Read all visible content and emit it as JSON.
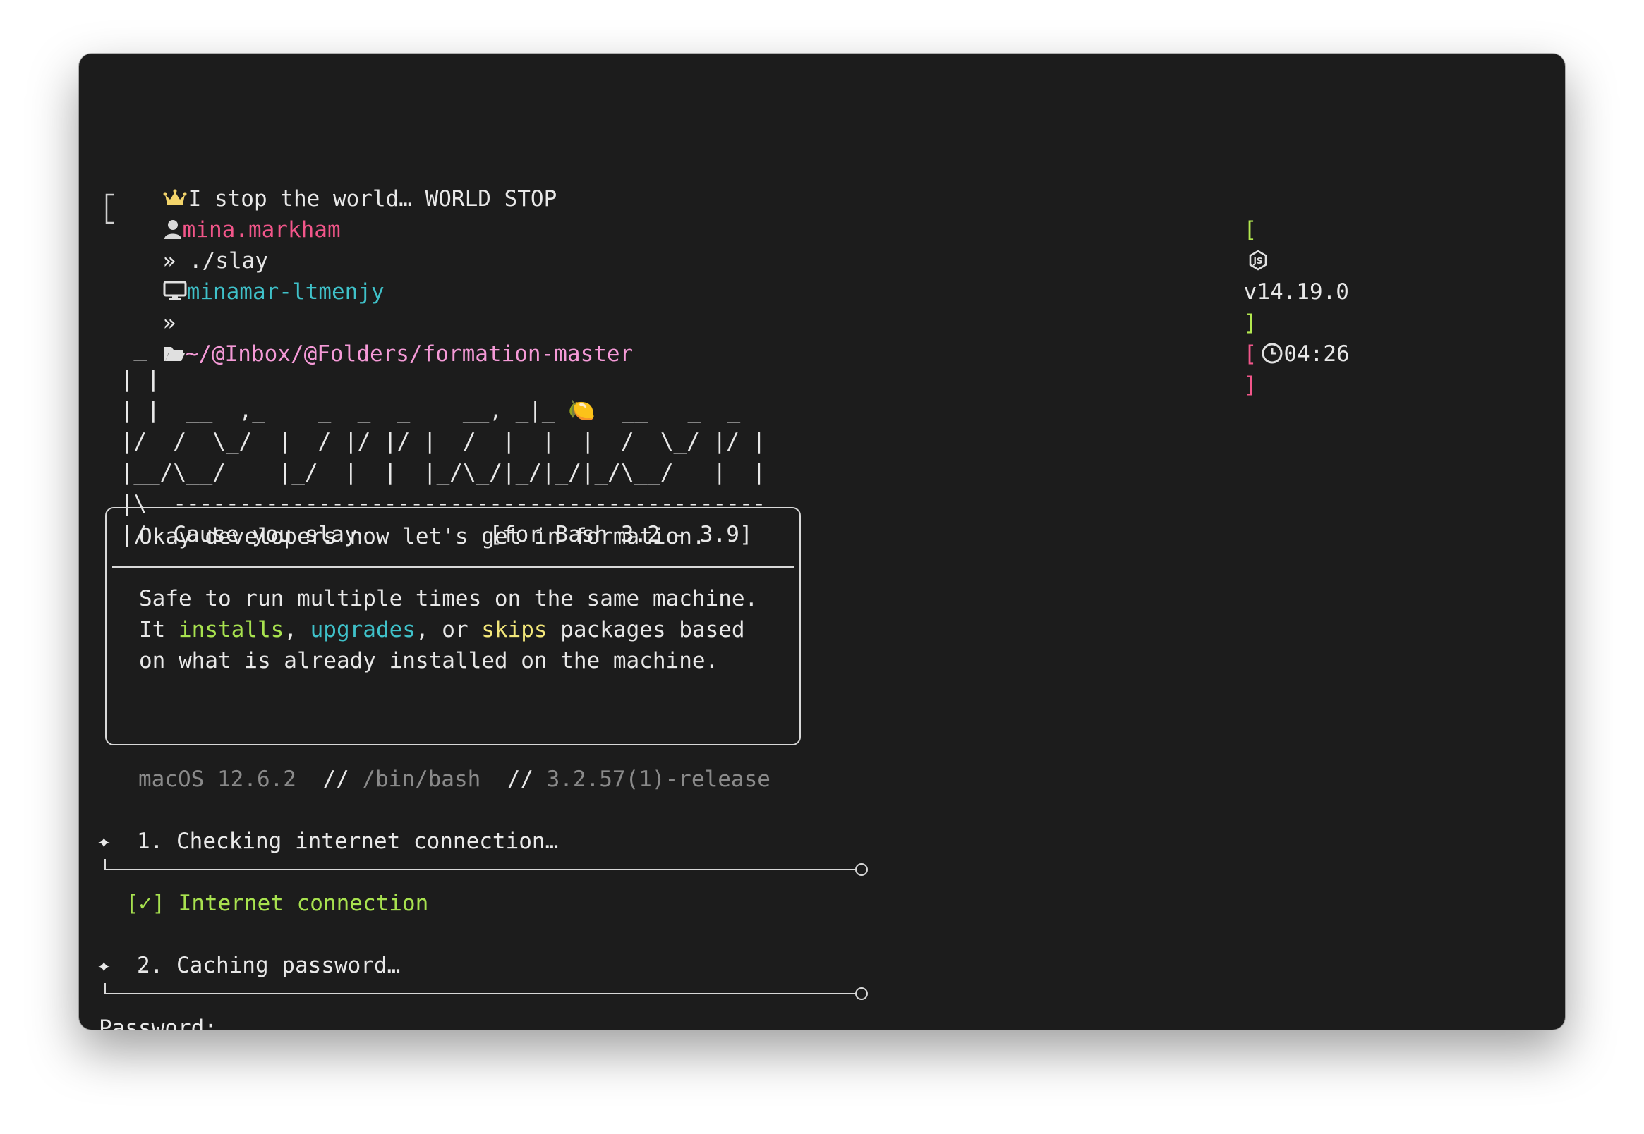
{
  "terminal": {
    "motd": "I stop the world… WORLD STOP",
    "prompt": {
      "user": "mina.markham",
      "host": "minamar-ltmenjy",
      "path": "~/@Inbox/@Folders/formation-master",
      "node_version": "v14.19.0",
      "time": "04:26",
      "separator": "»",
      "bracket_open": "[",
      "bracket_close": "]"
    },
    "command": "./slay",
    "banner": {
      "ascii_art": "  _\n | |\n | |  __  ,_    _  _  _    __, _|_ 🍋  __   _  _\n |/  /  \\_/  |  / |/ |/ |  /  |  |  |  /  \\_/ |/ |\n |__/\\__/    |_/  |  |  |_/\\_/|_/|_/|_/\\__/   |  |\n |\\  ---------------------------------------------\n |/  Cause you slay          [for Bash 3.2 - 3.9]"
    },
    "infobox": {
      "heading": "Okay developers now let's get in formation.",
      "line1": "Safe to run multiple times on the same machine.",
      "line2_prefix": "It ",
      "word_installs": "installs",
      "comma1": ", ",
      "word_upgrades": "upgrades",
      "comma2": ", or ",
      "word_skips": "skips",
      "line2_suffix": " packages based",
      "line3": "on what is already installed on the machine."
    },
    "system_info": {
      "os": "macOS 12.6.2",
      "divider": "//",
      "shell": "/bin/bash",
      "version": "3.2.57(1)-release"
    },
    "steps": [
      {
        "marker": "✦",
        "label": "1. Checking internet connection…"
      },
      {
        "marker": "✦",
        "label": "2. Caching password…"
      }
    ],
    "check_result": "[✓] Internet connection",
    "password_prompt": "Password:",
    "cursor": "_"
  },
  "colors": {
    "background": "#1c1c1c",
    "user": "#f2568a",
    "host": "#3fc1c9",
    "path": "#f59ad7",
    "success": "#a8e24f",
    "highlight_yellow": "#f3e77a",
    "dim": "#8a8a8a"
  }
}
